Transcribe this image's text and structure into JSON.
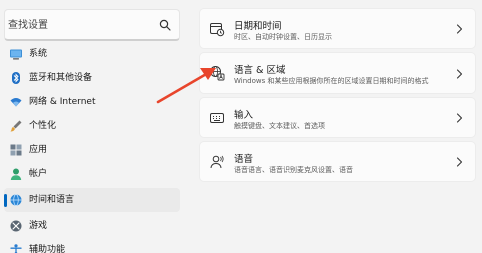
{
  "sidebar": {
    "search": {
      "placeholder": "查找设置"
    },
    "items": [
      {
        "label": "系统"
      },
      {
        "label": "蓝牙和其他设备"
      },
      {
        "label": "网络 & Internet"
      },
      {
        "label": "个性化"
      },
      {
        "label": "应用"
      },
      {
        "label": "帐户"
      },
      {
        "label": "时间和语言"
      },
      {
        "label": "游戏"
      },
      {
        "label": "辅助功能"
      }
    ]
  },
  "main": {
    "cards": [
      {
        "title": "日期和时间",
        "desc": "时区、自动时钟设置、日历显示"
      },
      {
        "title": "语言 & 区域",
        "desc": "Windows 和某些应用根据你所在的区域设置日期和时间的格式"
      },
      {
        "title": "输入",
        "desc": "触摸键盘、文本建议、首选项"
      },
      {
        "title": "语音",
        "desc": "语音语言、语音识别麦克风设置、语音"
      }
    ]
  },
  "colors": {
    "accent": "#0067c0",
    "annotation_arrow": "#e8452c"
  }
}
